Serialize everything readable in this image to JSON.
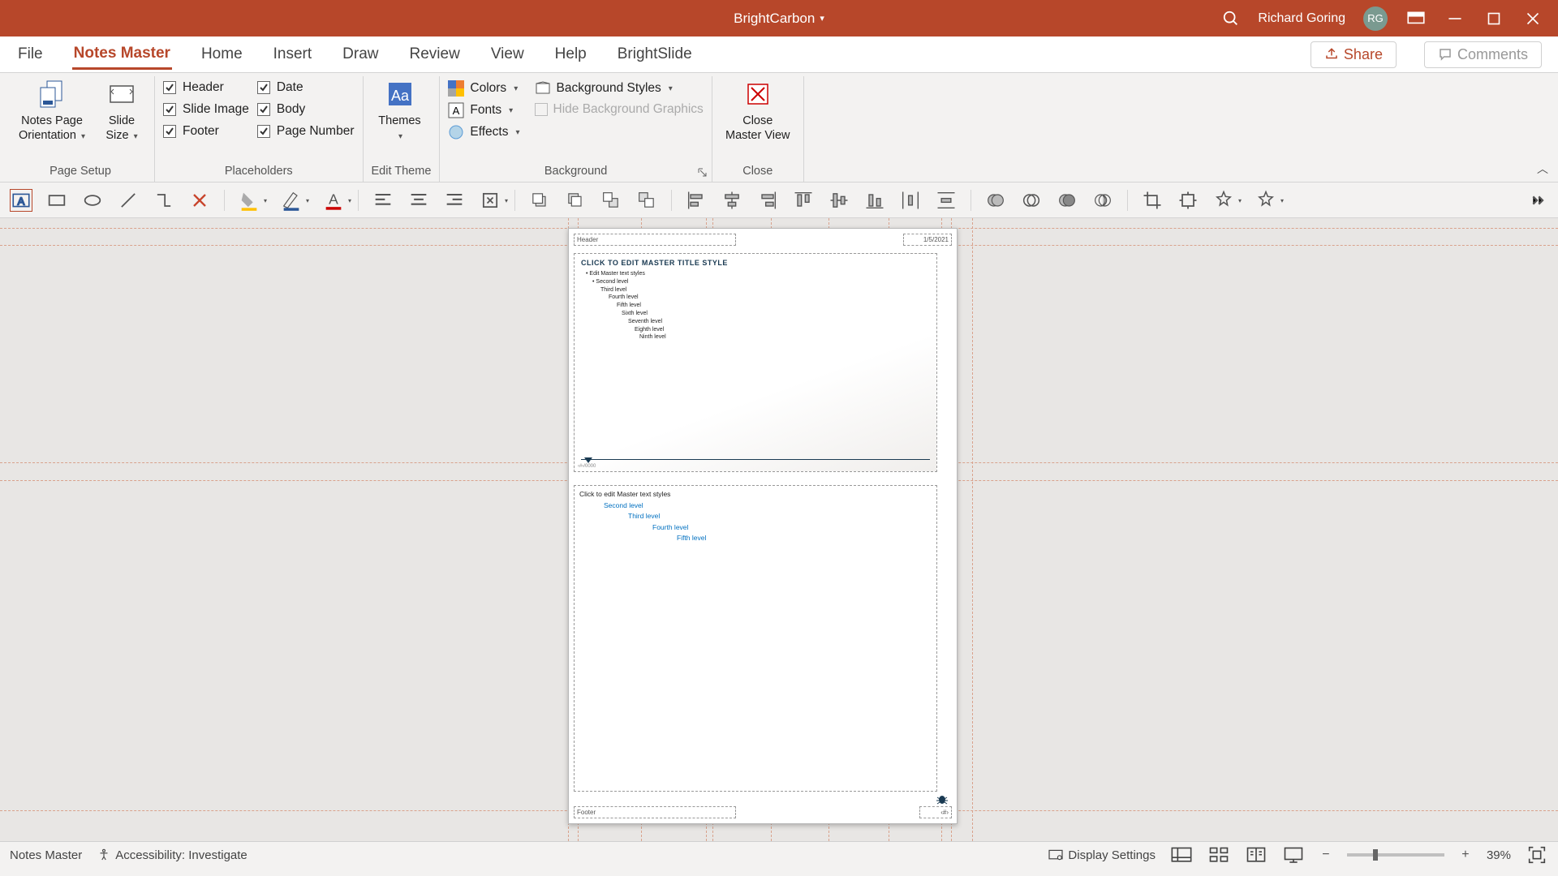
{
  "title_bar": {
    "doc_name": "BrightCarbon",
    "user_name": "Richard Goring",
    "user_initials": "RG"
  },
  "tabs": {
    "file": "File",
    "notes_master": "Notes Master",
    "home": "Home",
    "insert": "Insert",
    "draw": "Draw",
    "review": "Review",
    "view": "View",
    "help": "Help",
    "brightslide": "BrightSlide",
    "share": "Share",
    "comments": "Comments"
  },
  "ribbon": {
    "page_setup": {
      "label": "Page Setup",
      "orientation": "Notes Page\nOrientation",
      "slide_size": "Slide\nSize"
    },
    "placeholders": {
      "label": "Placeholders",
      "header": "Header",
      "slide_image": "Slide Image",
      "footer": "Footer",
      "date": "Date",
      "body": "Body",
      "page_number": "Page Number"
    },
    "edit_theme": {
      "label": "Edit Theme",
      "themes": "Themes"
    },
    "background": {
      "label": "Background",
      "colors": "Colors",
      "fonts": "Fonts",
      "effects": "Effects",
      "bg_styles": "Background Styles",
      "hide_bg": "Hide Background Graphics"
    },
    "close": {
      "label": "Close",
      "close_master": "Close\nMaster View"
    }
  },
  "slide_preview": {
    "header": "Header",
    "date": "1/5/2021",
    "title": "CLICK TO EDIT MASTER TITLE STYLE",
    "levels": [
      "Edit Master text styles",
      "Second level",
      "Third level",
      "Fourth level",
      "Fifth level",
      "Sixth level",
      "Seventh level",
      "Eighth level",
      "Ninth level"
    ],
    "body_title": "Click to edit Master text styles",
    "body_levels": [
      "Second level",
      "Third level",
      "Fourth level",
      "Fifth level"
    ],
    "footer": "Footer",
    "pgnum": "‹#›",
    "slide_pgnum": "‹#›/0000"
  },
  "status": {
    "mode": "Notes Master",
    "accessibility": "Accessibility: Investigate",
    "display": "Display Settings",
    "zoom": "39%"
  }
}
